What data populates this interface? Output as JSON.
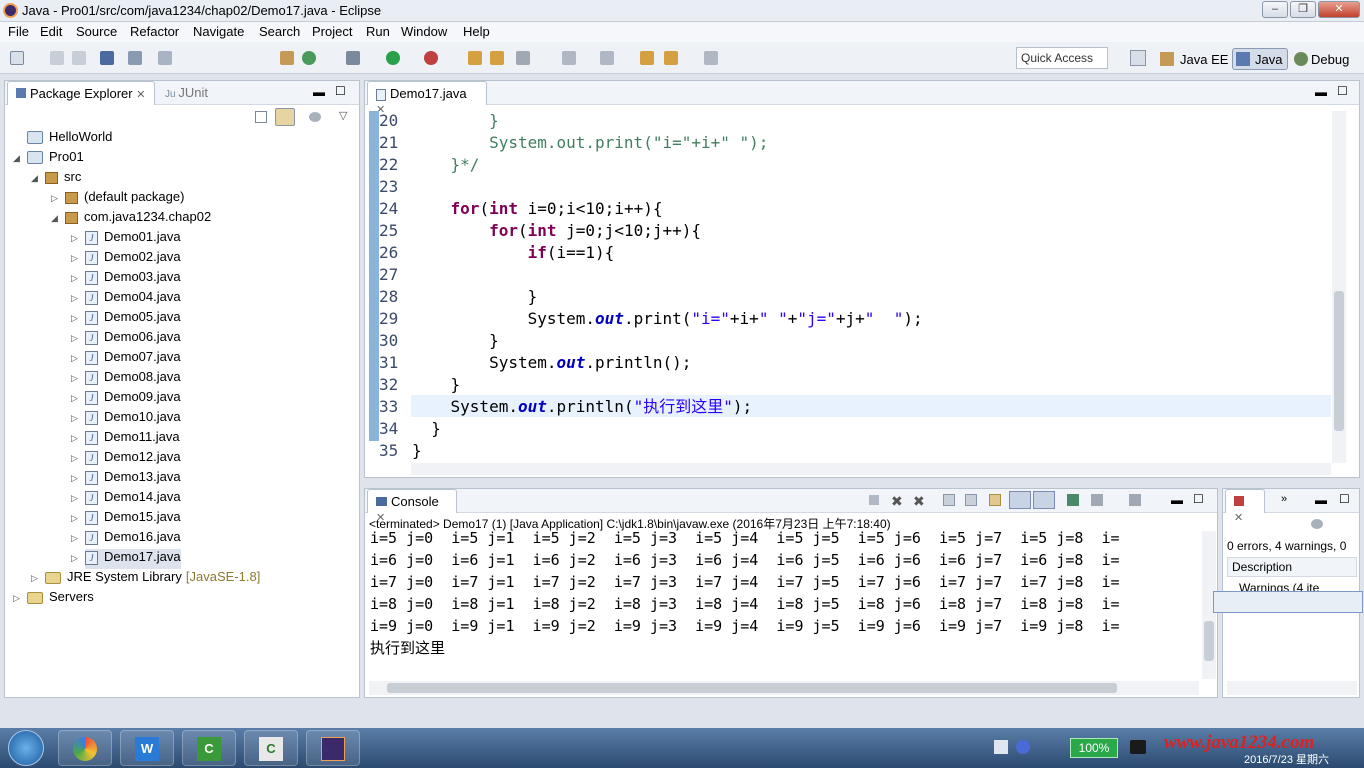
{
  "window": {
    "title": "Java - Pro01/src/com/java1234/chap02/Demo17.java - Eclipse"
  },
  "menu": [
    "File",
    "Edit",
    "Source",
    "Refactor",
    "Navigate",
    "Search",
    "Project",
    "Run",
    "Window",
    "Help"
  ],
  "toolbar": {
    "quick_access": "Quick Access",
    "perspectives": [
      "Java EE",
      "Java",
      "Debug"
    ]
  },
  "package_explorer": {
    "tabs": [
      "Package Explorer",
      "JUnit"
    ],
    "tree": [
      {
        "label": "HelloWorld",
        "level": 0
      },
      {
        "label": "Pro01",
        "level": 0
      },
      {
        "label": "src",
        "level": 1
      },
      {
        "label": "(default package)",
        "level": 2
      },
      {
        "label": "com.java1234.chap02",
        "level": 2
      },
      {
        "label": "Demo01.java",
        "level": 3
      },
      {
        "label": "Demo02.java",
        "level": 3
      },
      {
        "label": "Demo03.java",
        "level": 3
      },
      {
        "label": "Demo04.java",
        "level": 3
      },
      {
        "label": "Demo05.java",
        "level": 3
      },
      {
        "label": "Demo06.java",
        "level": 3
      },
      {
        "label": "Demo07.java",
        "level": 3
      },
      {
        "label": "Demo08.java",
        "level": 3
      },
      {
        "label": "Demo09.java",
        "level": 3
      },
      {
        "label": "Demo10.java",
        "level": 3
      },
      {
        "label": "Demo11.java",
        "level": 3
      },
      {
        "label": "Demo12.java",
        "level": 3
      },
      {
        "label": "Demo13.java",
        "level": 3
      },
      {
        "label": "Demo14.java",
        "level": 3
      },
      {
        "label": "Demo15.java",
        "level": 3
      },
      {
        "label": "Demo16.java",
        "level": 3
      },
      {
        "label": "Demo17.java",
        "level": 3
      },
      {
        "label": "JRE System Library",
        "level": 1
      },
      {
        "label": "Servers",
        "level": 0
      }
    ],
    "jre_suffix": "[JavaSE-1.8]"
  },
  "editor": {
    "tab": "Demo17.java",
    "line_numbers": [
      "20",
      "21",
      "22",
      "23",
      "24",
      "25",
      "26",
      "27",
      "28",
      "29",
      "30",
      "31",
      "32",
      "33",
      "34",
      "35"
    ]
  },
  "console": {
    "tab": "Console",
    "status": "<terminated> Demo17 (1) [Java Application] C:\\jdk1.8\\bin\\javaw.exe (2016年7月23日 上午7:18:40)",
    "lines": [
      "i=5 j=0  i=5 j=1  i=5 j=2  i=5 j=3  i=5 j=4  i=5 j=5  i=5 j=6  i=5 j=7  i=5 j=8  i=",
      "i=6 j=0  i=6 j=1  i=6 j=2  i=6 j=3  i=6 j=4  i=6 j=5  i=6 j=6  i=6 j=7  i=6 j=8  i=",
      "i=7 j=0  i=7 j=1  i=7 j=2  i=7 j=3  i=7 j=4  i=7 j=5  i=7 j=6  i=7 j=7  i=7 j=8  i=",
      "i=8 j=0  i=8 j=1  i=8 j=2  i=8 j=3  i=8 j=4  i=8 j=5  i=8 j=6  i=8 j=7  i=8 j=8  i=",
      "i=9 j=0  i=9 j=1  i=9 j=2  i=9 j=3  i=9 j=4  i=9 j=5  i=9 j=6  i=9 j=7  i=9 j=8  i=",
      "执行到这里"
    ]
  },
  "problems": {
    "summary": "0 errors, 4 warnings, 0",
    "column": "Description",
    "item": "Warnings (4 ite"
  },
  "taskbar": {
    "zoom": "100%",
    "watermark": "www.java1234.com",
    "date": "2016/7/23 星期六"
  }
}
